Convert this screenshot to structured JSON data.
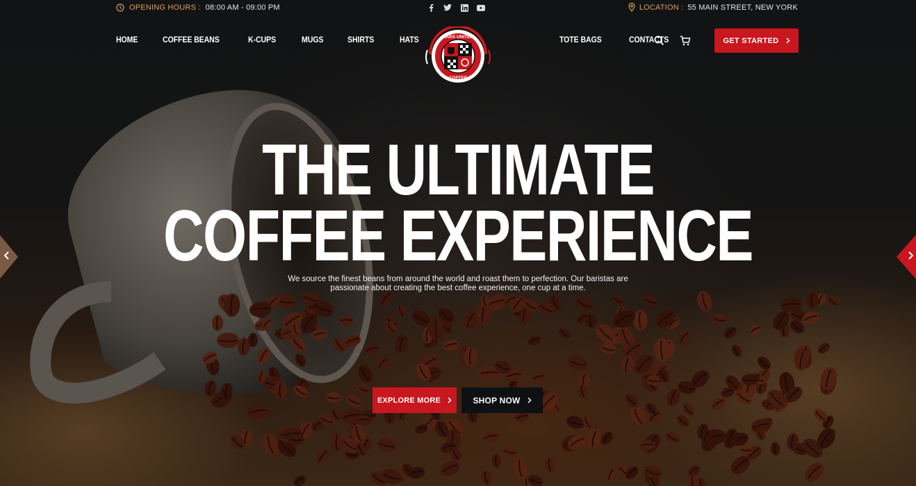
{
  "topbar": {
    "hours_label": "OPENING  HOURS :",
    "hours_value": "08:00 AM - 09:00 PM",
    "location_label": "LOCATION :",
    "location_value": "55 MAIN STREET, NEW YORK",
    "social": [
      "facebook-icon",
      "twitter-icon",
      "linkedin-icon",
      "youtube-icon"
    ]
  },
  "nav": {
    "left": [
      "HOME",
      "COFFEE BEANS",
      "K-CUPS",
      "MUGS",
      "SHIRTS",
      "HATS"
    ],
    "right": [
      "TOTE BAGS",
      "CONTACTS"
    ],
    "cta_label": "GET STARTED"
  },
  "logo": {
    "text_top": "CARS UNITED",
    "text_bottom": "COFFEE"
  },
  "hero": {
    "headline_line1": "THE ULTIMATE",
    "headline_line2": "COFFEE EXPERIENCE",
    "subtitle": "We source the finest beans from around the world and roast them to perfection. Our baristas are passionate about creating the best coffee experience, one cup at a time.",
    "primary_button": "EXPLORE MORE",
    "secondary_button": "SHOP NOW"
  },
  "colors": {
    "accent": "#c8171e",
    "label_gold": "#d9a063",
    "dark": "#0e1014"
  }
}
